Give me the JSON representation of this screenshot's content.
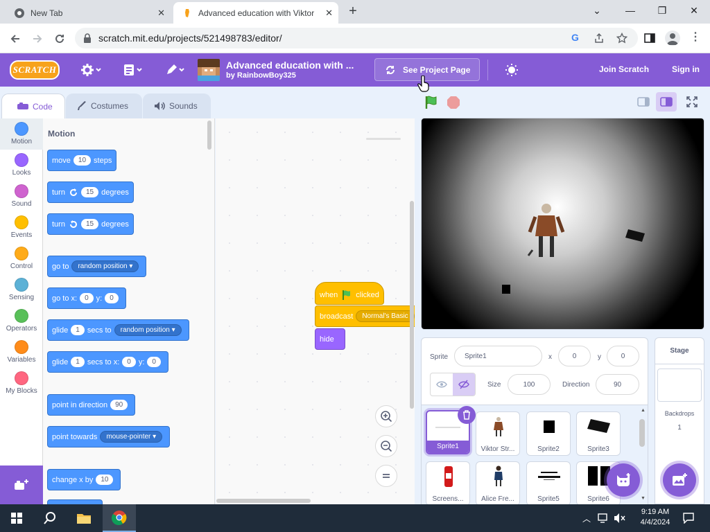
{
  "browser": {
    "tabs": [
      {
        "title": "New Tab",
        "icon": "chrome-icon",
        "close": "✕"
      },
      {
        "title": "Advanced education with Viktor",
        "icon": "scratch-favicon",
        "close": "✕"
      }
    ],
    "new_tab": "+",
    "window_controls": {
      "minimize": "⌄",
      "min": "—",
      "restore": "❐",
      "close": "✕"
    },
    "url": "scratch.mit.edu/projects/521498783/editor/"
  },
  "scratch_menu": {
    "logo": "SCRATCH",
    "project_title": "Advanced education with ...",
    "author": "by RainbowBoy325",
    "see_project_page": "See Project Page",
    "join": "Join Scratch",
    "sign_in": "Sign in"
  },
  "editor_tabs": [
    {
      "label": "Code"
    },
    {
      "label": "Costumes"
    },
    {
      "label": "Sounds"
    }
  ],
  "categories": [
    {
      "label": "Motion",
      "color": "#4c97ff"
    },
    {
      "label": "Looks",
      "color": "#9966ff"
    },
    {
      "label": "Sound",
      "color": "#cf63cf"
    },
    {
      "label": "Events",
      "color": "#ffbf00"
    },
    {
      "label": "Control",
      "color": "#ffab19"
    },
    {
      "label": "Sensing",
      "color": "#5cb1d6"
    },
    {
      "label": "Operators",
      "color": "#59c059"
    },
    {
      "label": "Variables",
      "color": "#ff8c1a"
    },
    {
      "label": "My Blocks",
      "color": "#ff6680"
    }
  ],
  "palette": {
    "title": "Motion",
    "move": {
      "a": "move",
      "v": "10",
      "b": "steps"
    },
    "turn_right": {
      "a": "turn",
      "v": "15",
      "b": "degrees"
    },
    "turn_left": {
      "a": "turn",
      "v": "15",
      "b": "degrees"
    },
    "goto": {
      "a": "go to",
      "dd": "random position"
    },
    "goto_xy": {
      "a": "go to x:",
      "x": "0",
      "b": "y:",
      "y": "0"
    },
    "glide": {
      "a": "glide",
      "v": "1",
      "b": "secs to",
      "dd": "random position"
    },
    "glide_xy": {
      "a": "glide",
      "v": "1",
      "b": "secs to x:",
      "x": "0",
      "c": "y:",
      "y": "0"
    },
    "point_dir": {
      "a": "point in direction",
      "v": "90"
    },
    "point_towards": {
      "a": "point towards",
      "dd": "mouse-pointer"
    },
    "change_x": {
      "a": "change x by",
      "v": "10"
    }
  },
  "script": {
    "hat": {
      "a": "when",
      "b": "clicked"
    },
    "broadcast": {
      "a": "broadcast",
      "dd": "Normal's Basic"
    },
    "hide": "hide"
  },
  "sprite_info": {
    "sprite_label": "Sprite",
    "sprite_name": "Sprite1",
    "x_label": "x",
    "x": "0",
    "y_label": "y",
    "y": "0",
    "show_label": "Show",
    "size_label": "Size",
    "size": "100",
    "direction_label": "Direction",
    "direction": "90"
  },
  "sprites": [
    {
      "name": "Sprite1",
      "selected": true
    },
    {
      "name": "Viktor Str..."
    },
    {
      "name": "Sprite2"
    },
    {
      "name": "Sprite3"
    },
    {
      "name": "Screens..."
    },
    {
      "name": "Alice Fre..."
    },
    {
      "name": "Sprite5"
    },
    {
      "name": "Sprite6"
    }
  ],
  "stage_pane": {
    "title": "Stage",
    "backdrops_label": "Backdrops",
    "backdrops_count": "1"
  },
  "taskbar": {
    "time": "9:19 AM",
    "date": "4/4/2024"
  }
}
